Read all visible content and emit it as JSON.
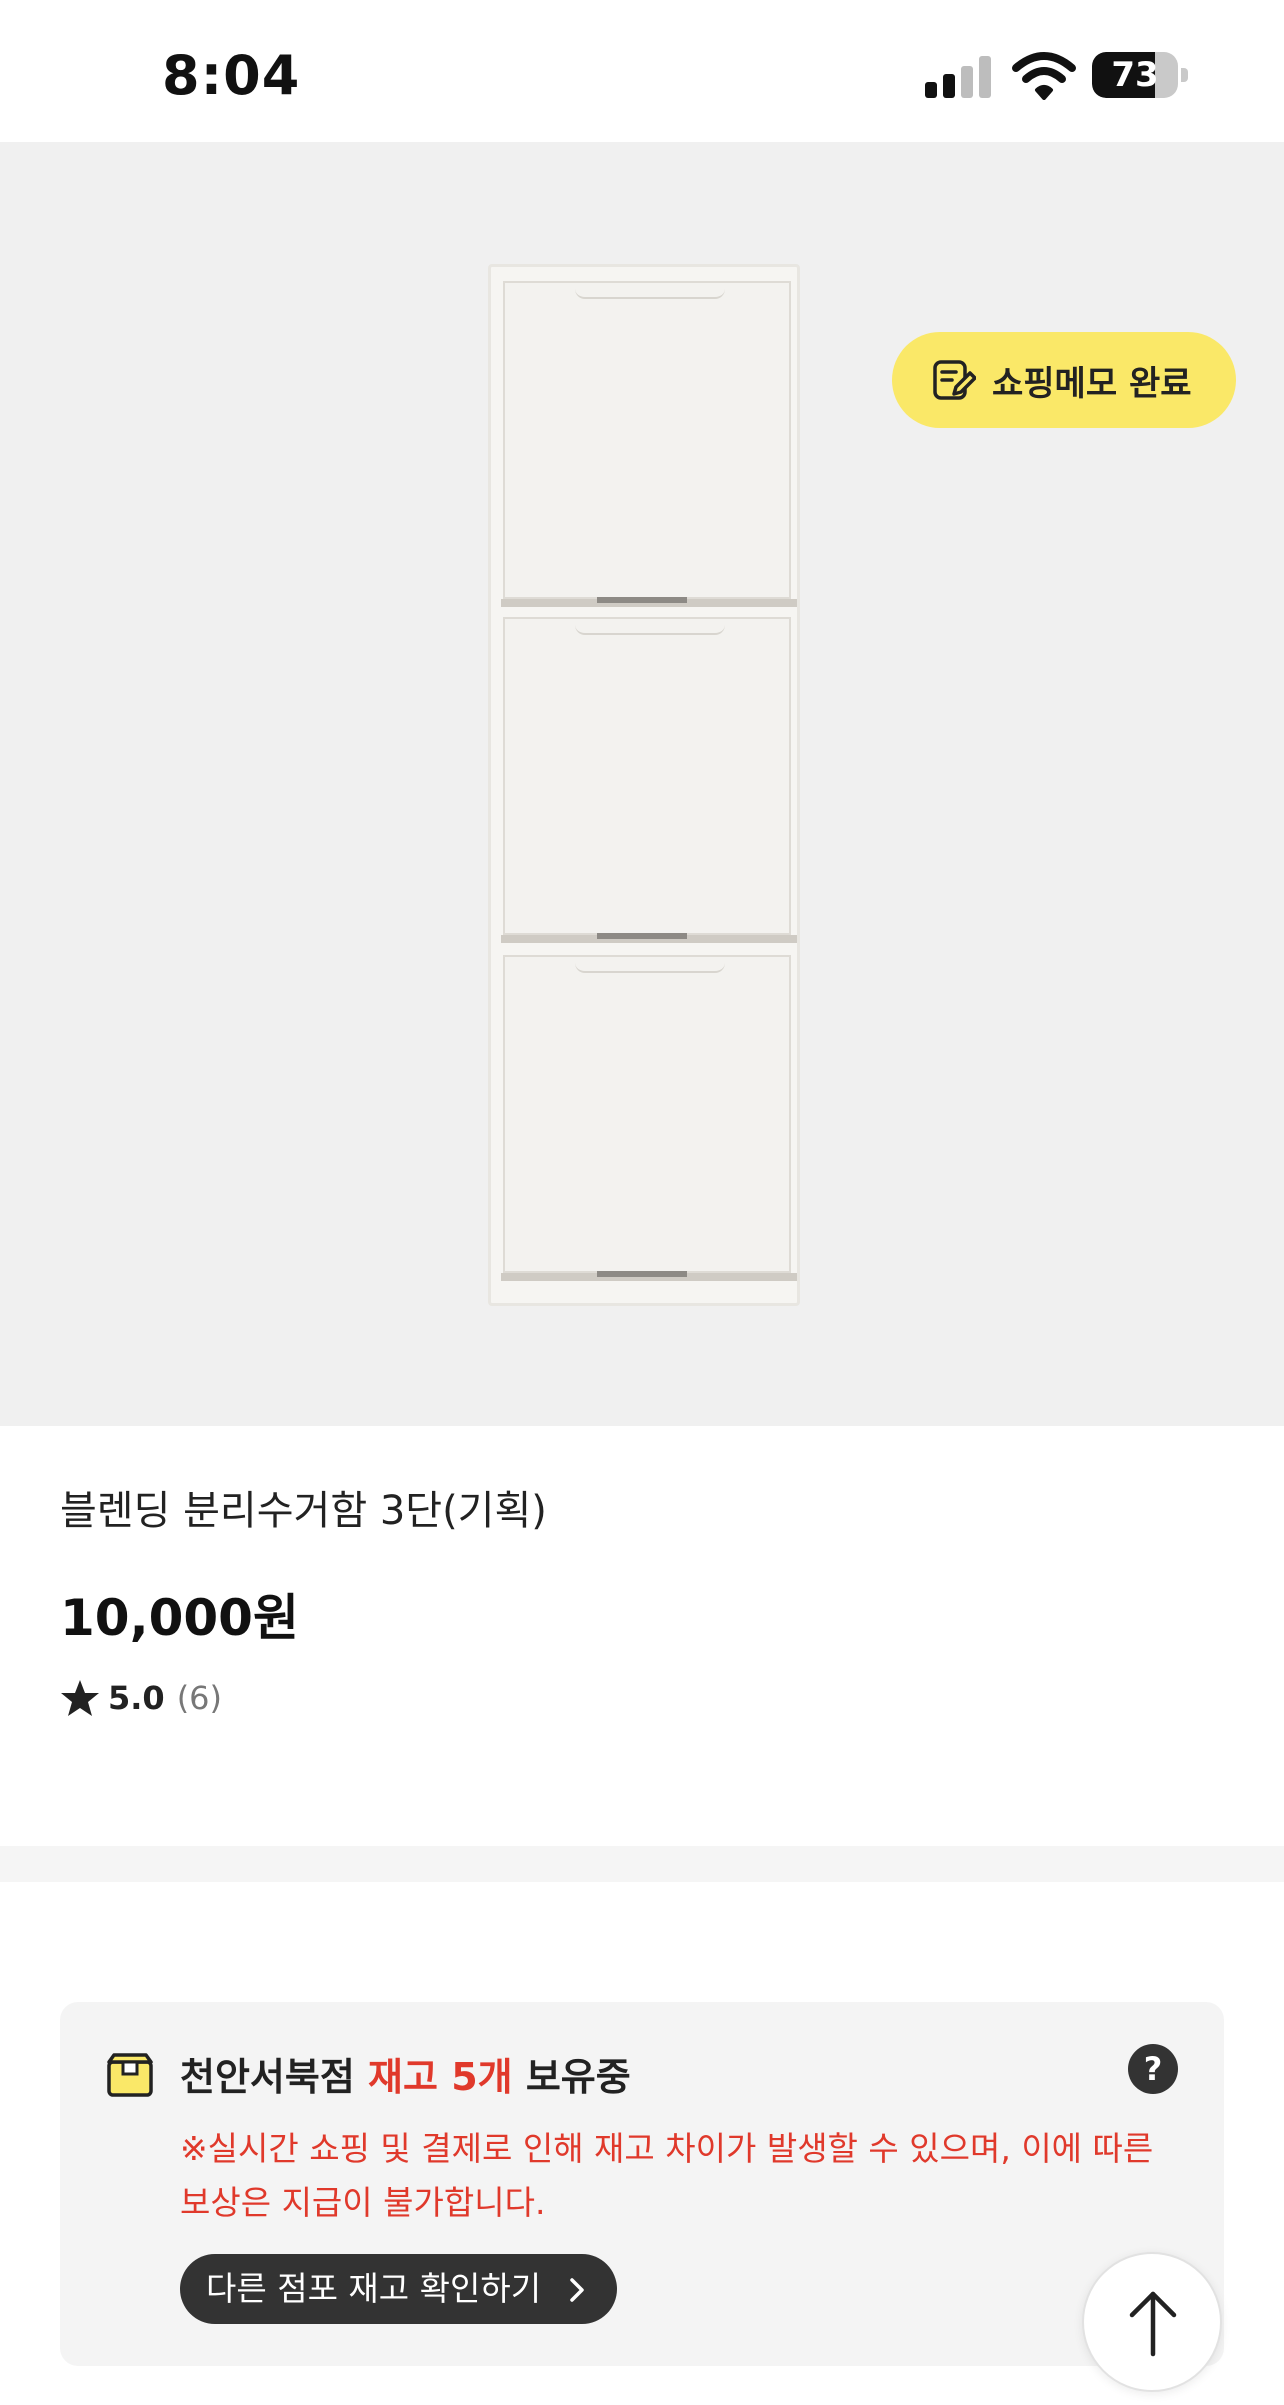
{
  "status_bar": {
    "time": "8:04",
    "battery": "73",
    "battery_level": 0.73
  },
  "shopping_memo": {
    "label": "쇼핑메모 완료"
  },
  "product": {
    "name": "블렌딩 분리수거함 3단(기획)",
    "price": "10,000원",
    "rating": "5.0",
    "review_count": "(6)"
  },
  "stock": {
    "store": "천안서북점",
    "stock_text": "재고 5개",
    "suffix": "보유중",
    "help": "?",
    "notice": "※실시간 쇼핑 및 결제로 인해 재고 차이가 발생할 수 있으며, 이에 따른 보상은 지급이 불가합니다.",
    "other_stores_button": "다른 점포 재고 확인하기"
  },
  "colors": {
    "accent_red": "#e0392b",
    "memo_yellow": "#fae868",
    "image_bg": "#f0f0f0"
  }
}
